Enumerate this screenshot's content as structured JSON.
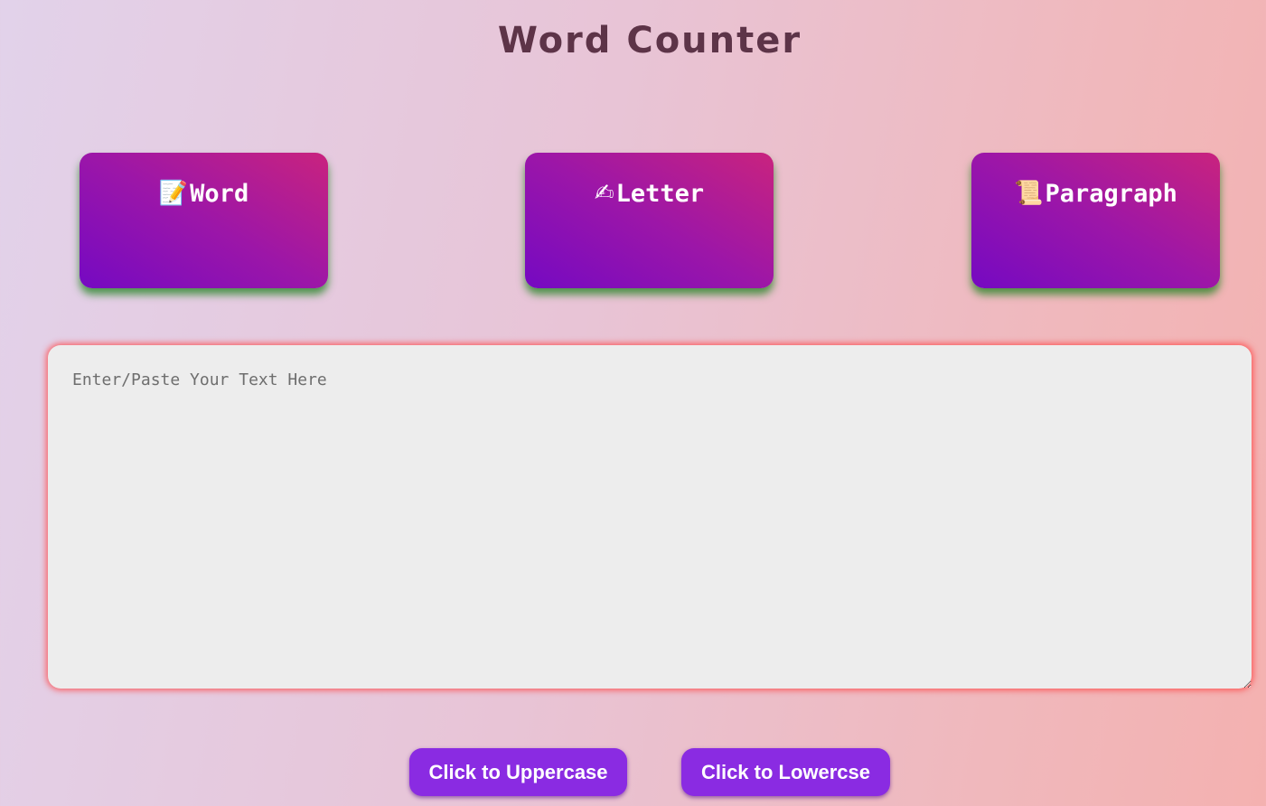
{
  "header": {
    "title": "Word Counter"
  },
  "stats": [
    {
      "id": "word",
      "icon": "memo-icon",
      "emoji": "📝",
      "label": "Word",
      "count": ""
    },
    {
      "id": "letter",
      "icon": "writing-hand-icon",
      "emoji": "✍",
      "label": "Letter",
      "count": ""
    },
    {
      "id": "paragraph",
      "icon": "scroll-icon",
      "emoji": "📜",
      "label": "Paragraph",
      "count": ""
    }
  ],
  "editor": {
    "placeholder": "Enter/Paste Your Text Here",
    "value": ""
  },
  "actions": {
    "uppercase_label": "Click to Uppercase",
    "lowercase_label": "Click to Lowercse"
  },
  "colors": {
    "title": "#5d3448",
    "card_gradient_start": "#7509c2",
    "card_gradient_end": "#c9237e",
    "card_shadow": "#1e821e",
    "textarea_glow": "#ff4646",
    "button": "#8a2be2"
  }
}
